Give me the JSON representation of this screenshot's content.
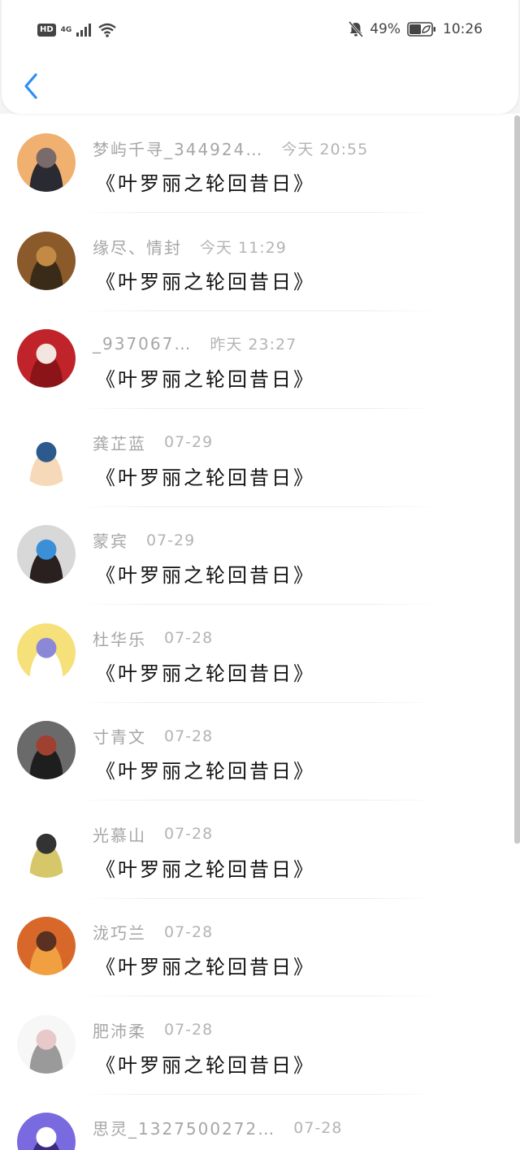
{
  "status_bar": {
    "hd": "HD",
    "network": "4G",
    "battery": "49%",
    "time": "10:26"
  },
  "icons": {
    "back": "chevron-left-icon",
    "signal": "signal-icon",
    "wifi": "wifi-icon",
    "mute": "bell-off-icon",
    "battery": "battery-icon"
  },
  "accent_color": "#2a8ff7",
  "messages": [
    {
      "name": "梦屿千寻_344924…",
      "time": "今天 20:55",
      "text": "《叶罗丽之轮回昔日》",
      "avatar_colors": [
        "#f0b070",
        "#7a6a6a",
        "#2a2a33"
      ]
    },
    {
      "name": "缘尽、情封",
      "time": "今天 11:29",
      "text": "《叶罗丽之轮回昔日》",
      "avatar_colors": [
        "#8a5a2a",
        "#c38a45",
        "#3a2a18"
      ]
    },
    {
      "name": "_937067…",
      "time": "昨天 23:27",
      "text": "《叶罗丽之轮回昔日》",
      "avatar_colors": [
        "#c0242a",
        "#f3e6e0",
        "#8a1418"
      ]
    },
    {
      "name": "龚芷蓝",
      "time": "07-29",
      "text": "《叶罗丽之轮回昔日》",
      "avatar_colors": [
        "#ffffff",
        "#2d5a8c",
        "#f6d9b8"
      ]
    },
    {
      "name": "蒙宾",
      "time": "07-29",
      "text": "《叶罗丽之轮回昔日》",
      "avatar_colors": [
        "#d8d8d8",
        "#3b8fd6",
        "#2a2020"
      ]
    },
    {
      "name": "杜华乐",
      "time": "07-28",
      "text": "《叶罗丽之轮回昔日》",
      "avatar_colors": [
        "#f6e07a",
        "#8c88d8",
        "#ffffff"
      ]
    },
    {
      "name": "寸青文",
      "time": "07-28",
      "text": "《叶罗丽之轮回昔日》",
      "avatar_colors": [
        "#6a6a6a",
        "#a04030",
        "#1e1e1e"
      ]
    },
    {
      "name": "光慕山",
      "time": "07-28",
      "text": "《叶罗丽之轮回昔日》",
      "avatar_colors": [
        "#ffffff",
        "#333333",
        "#d6c86a"
      ]
    },
    {
      "name": "泷巧兰",
      "time": "07-28",
      "text": "《叶罗丽之轮回昔日》",
      "avatar_colors": [
        "#d8682a",
        "#5a3020",
        "#f0a040"
      ]
    },
    {
      "name": "肥沛柔",
      "time": "07-28",
      "text": "《叶罗丽之轮回昔日》",
      "avatar_colors": [
        "#f7f7f7",
        "#e8c8c8",
        "#9a9a9a"
      ]
    },
    {
      "name": "思灵_1327500272…",
      "time": "07-28",
      "text": "",
      "avatar_colors": [
        "#7a6ae0",
        "#ffffff",
        "#3a2a80"
      ]
    }
  ]
}
